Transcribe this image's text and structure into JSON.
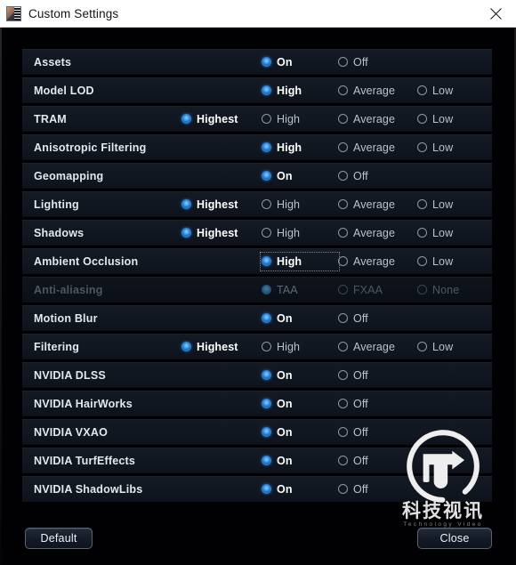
{
  "window": {
    "title": "Custom Settings",
    "app_icon": "game-app-icon",
    "close_icon": "close-icon"
  },
  "settings": {
    "rows": [
      {
        "label": "Assets",
        "disabled": false,
        "options": [
          {
            "label": "On",
            "column": 1,
            "checked": true,
            "focused": false
          },
          {
            "label": "Off",
            "column": 2,
            "checked": false,
            "focused": false
          }
        ]
      },
      {
        "label": "Model LOD",
        "disabled": false,
        "options": [
          {
            "label": "High",
            "column": 1,
            "checked": true,
            "focused": false
          },
          {
            "label": "Average",
            "column": 2,
            "checked": false,
            "focused": false
          },
          {
            "label": "Low",
            "column": 3,
            "checked": false,
            "focused": false
          }
        ]
      },
      {
        "label": "TRAM",
        "disabled": false,
        "options": [
          {
            "label": "Highest",
            "column": 0,
            "checked": true,
            "focused": false
          },
          {
            "label": "High",
            "column": 1,
            "checked": false,
            "focused": false
          },
          {
            "label": "Average",
            "column": 2,
            "checked": false,
            "focused": false
          },
          {
            "label": "Low",
            "column": 3,
            "checked": false,
            "focused": false
          }
        ]
      },
      {
        "label": "Anisotropic Filtering",
        "disabled": false,
        "options": [
          {
            "label": "High",
            "column": 1,
            "checked": true,
            "focused": false
          },
          {
            "label": "Average",
            "column": 2,
            "checked": false,
            "focused": false
          },
          {
            "label": "Low",
            "column": 3,
            "checked": false,
            "focused": false
          }
        ]
      },
      {
        "label": "Geomapping",
        "disabled": false,
        "options": [
          {
            "label": "On",
            "column": 1,
            "checked": true,
            "focused": false
          },
          {
            "label": "Off",
            "column": 2,
            "checked": false,
            "focused": false
          }
        ]
      },
      {
        "label": "Lighting",
        "disabled": false,
        "options": [
          {
            "label": "Highest",
            "column": 0,
            "checked": true,
            "focused": false
          },
          {
            "label": "High",
            "column": 1,
            "checked": false,
            "focused": false
          },
          {
            "label": "Average",
            "column": 2,
            "checked": false,
            "focused": false
          },
          {
            "label": "Low",
            "column": 3,
            "checked": false,
            "focused": false
          }
        ]
      },
      {
        "label": "Shadows",
        "disabled": false,
        "options": [
          {
            "label": "Highest",
            "column": 0,
            "checked": true,
            "focused": false
          },
          {
            "label": "High",
            "column": 1,
            "checked": false,
            "focused": false
          },
          {
            "label": "Average",
            "column": 2,
            "checked": false,
            "focused": false
          },
          {
            "label": "Low",
            "column": 3,
            "checked": false,
            "focused": false
          }
        ]
      },
      {
        "label": "Ambient Occlusion",
        "disabled": false,
        "options": [
          {
            "label": "High",
            "column": 1,
            "checked": true,
            "focused": true
          },
          {
            "label": "Average",
            "column": 2,
            "checked": false,
            "focused": false
          },
          {
            "label": "Low",
            "column": 3,
            "checked": false,
            "focused": false
          }
        ]
      },
      {
        "label": "Anti-aliasing",
        "disabled": true,
        "options": [
          {
            "label": "TAA",
            "column": 1,
            "checked": true,
            "focused": false
          },
          {
            "label": "FXAA",
            "column": 2,
            "checked": false,
            "focused": false
          },
          {
            "label": "None",
            "column": 3,
            "checked": false,
            "focused": false
          }
        ]
      },
      {
        "label": "Motion Blur",
        "disabled": false,
        "options": [
          {
            "label": "On",
            "column": 1,
            "checked": true,
            "focused": false
          },
          {
            "label": "Off",
            "column": 2,
            "checked": false,
            "focused": false
          }
        ]
      },
      {
        "label": "Filtering",
        "disabled": false,
        "options": [
          {
            "label": "Highest",
            "column": 0,
            "checked": true,
            "focused": false
          },
          {
            "label": "High",
            "column": 1,
            "checked": false,
            "focused": false
          },
          {
            "label": "Average",
            "column": 2,
            "checked": false,
            "focused": false
          },
          {
            "label": "Low",
            "column": 3,
            "checked": false,
            "focused": false
          }
        ]
      },
      {
        "label": "NVIDIA DLSS",
        "disabled": false,
        "options": [
          {
            "label": "On",
            "column": 1,
            "checked": true,
            "focused": false
          },
          {
            "label": "Off",
            "column": 2,
            "checked": false,
            "focused": false
          }
        ]
      },
      {
        "label": "NVIDIA HairWorks",
        "disabled": false,
        "options": [
          {
            "label": "On",
            "column": 1,
            "checked": true,
            "focused": false
          },
          {
            "label": "Off",
            "column": 2,
            "checked": false,
            "focused": false
          }
        ]
      },
      {
        "label": "NVIDIA VXAO",
        "disabled": false,
        "options": [
          {
            "label": "On",
            "column": 1,
            "checked": true,
            "focused": false
          },
          {
            "label": "Off",
            "column": 2,
            "checked": false,
            "focused": false
          }
        ]
      },
      {
        "label": "NVIDIA TurfEffects",
        "disabled": false,
        "options": [
          {
            "label": "On",
            "column": 1,
            "checked": true,
            "focused": false
          },
          {
            "label": "Off",
            "column": 2,
            "checked": false,
            "focused": false
          }
        ]
      },
      {
        "label": "NVIDIA ShadowLibs",
        "disabled": false,
        "options": [
          {
            "label": "On",
            "column": 1,
            "checked": true,
            "focused": false
          },
          {
            "label": "Off",
            "column": 2,
            "checked": false,
            "focused": false
          }
        ]
      }
    ]
  },
  "footer": {
    "default_label": "Default",
    "close_label": "Close"
  },
  "watermark": {
    "logo_icon": "tv-monogram-logo",
    "title_cn": "科技视讯",
    "subtitle_en": "Technology Video"
  },
  "colors": {
    "accent_selected": "#1675cf",
    "row_background": "#111721",
    "page_background": "#010103",
    "titlebar_background": "#ffffff",
    "label_text": "#e3e8ef",
    "disabled_text": "#4d5662"
  }
}
